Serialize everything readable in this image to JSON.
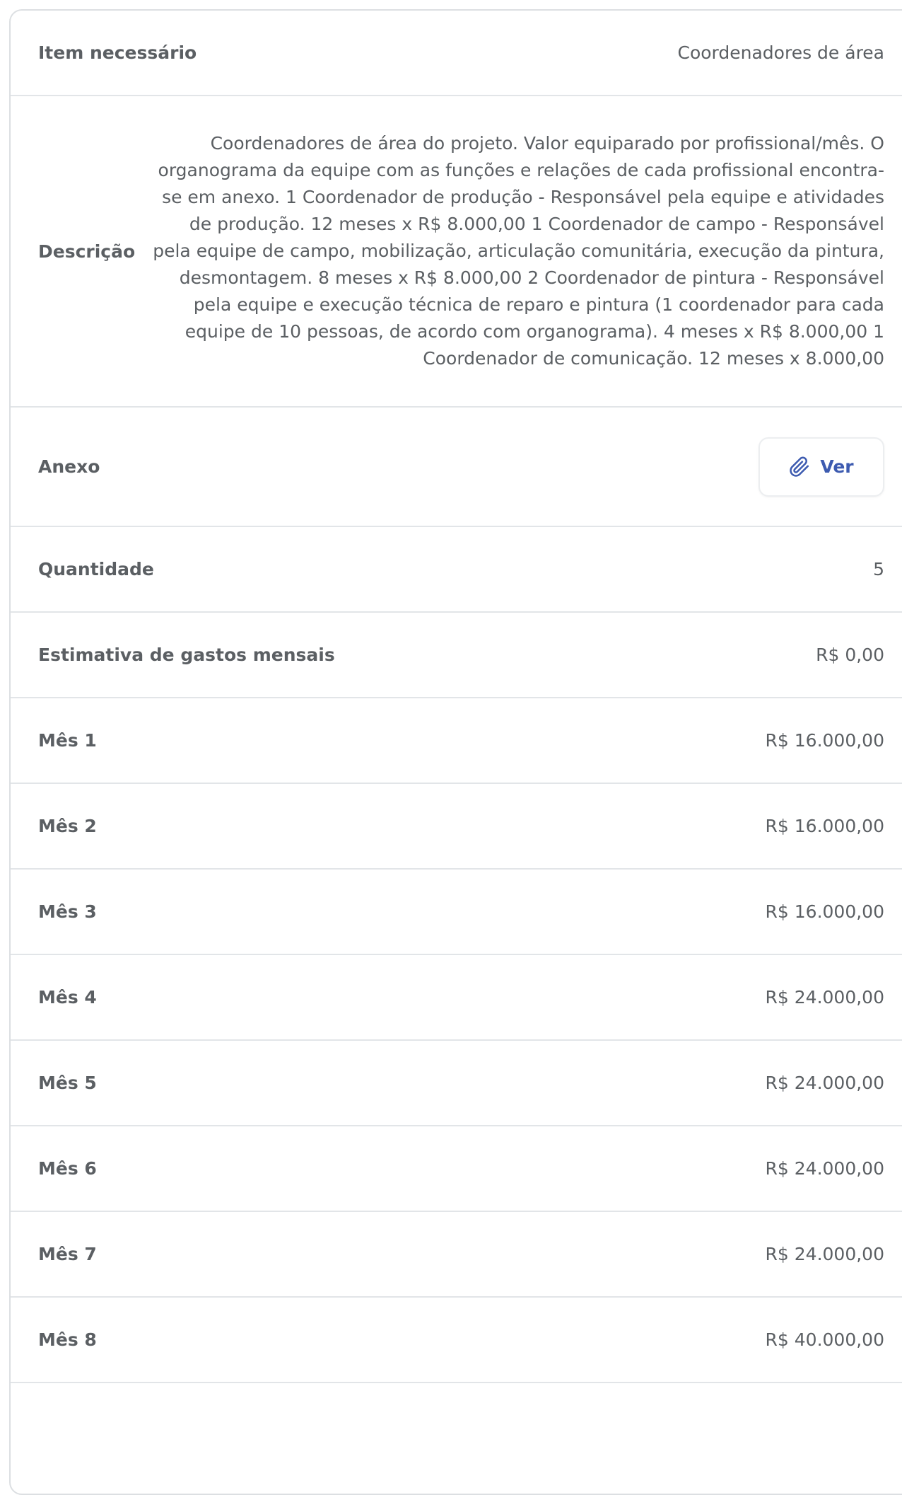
{
  "colors": {
    "accent": "#3d5bb0",
    "text": "#5b5f63",
    "border": "#e2e5e8"
  },
  "item": {
    "label": "Item necessário",
    "value": "Coordenadores de área"
  },
  "description": {
    "label": "Descrição",
    "value": "Coordenadores de área do projeto. Valor equiparado por profissional/mês. O organograma da equipe com as funções e relações de cada profissional encontra-se em anexo. 1 Coordenador de produção - Responsável pela equipe e atividades de produção. 12 meses x R$ 8.000,00 1 Coordenador de campo - Responsável pela equipe de campo, mobilização, articulação comunitária, execução da pintura, desmontagem. 8 meses x R$ 8.000,00 2 Coordenador de pintura - Responsável pela equipe e execução técnica de reparo e pintura (1 coordenador para cada equipe de 10 pessoas, de acordo com organograma). 4 meses x R$ 8.000,00 1 Coordenador de comunicação. 12 meses x 8.000,00"
  },
  "attachment": {
    "label": "Anexo",
    "button_label": "Ver",
    "icon": "paperclip-icon"
  },
  "quantity": {
    "label": "Quantidade",
    "value": "5"
  },
  "monthly_estimate": {
    "label": "Estimativa de gastos mensais",
    "value": "R$ 0,00"
  },
  "months": [
    {
      "label": "Mês 1",
      "value": "R$ 16.000,00"
    },
    {
      "label": "Mês 2",
      "value": "R$ 16.000,00"
    },
    {
      "label": "Mês 3",
      "value": "R$ 16.000,00"
    },
    {
      "label": "Mês 4",
      "value": "R$ 24.000,00"
    },
    {
      "label": "Mês 5",
      "value": "R$ 24.000,00"
    },
    {
      "label": "Mês 6",
      "value": "R$ 24.000,00"
    },
    {
      "label": "Mês 7",
      "value": "R$ 24.000,00"
    },
    {
      "label": "Mês 8",
      "value": "R$ 40.000,00"
    }
  ]
}
